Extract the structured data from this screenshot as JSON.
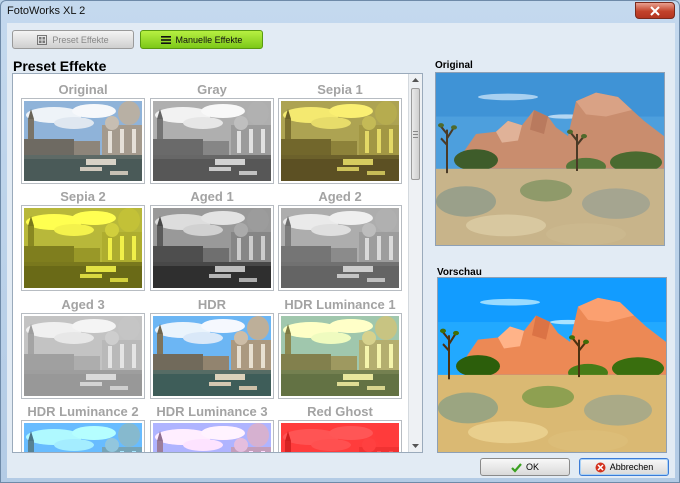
{
  "window": {
    "title": "FotoWorks XL 2"
  },
  "tabs": {
    "preset_label": "Preset Effekte",
    "manual_label": "Manuelle Effekte"
  },
  "section": {
    "title": "Preset Effekte"
  },
  "presets": [
    {
      "label": "Original",
      "filter": "original"
    },
    {
      "label": "Gray",
      "filter": "gray"
    },
    {
      "label": "Sepia 1",
      "filter": "sepia1"
    },
    {
      "label": "Sepia 2",
      "filter": "sepia2"
    },
    {
      "label": "Aged 1",
      "filter": "aged1"
    },
    {
      "label": "Aged 2",
      "filter": "aged2"
    },
    {
      "label": "Aged 3",
      "filter": "aged3"
    },
    {
      "label": "HDR",
      "filter": "hdr"
    },
    {
      "label": "HDR Luminance 1",
      "filter": "hdrlum1"
    },
    {
      "label": "HDR Luminance 2",
      "filter": "hdrlum2"
    },
    {
      "label": "HDR Luminance 3",
      "filter": "hdrlum3"
    },
    {
      "label": "Red Ghost",
      "filter": "redghost"
    }
  ],
  "original": {
    "label": "Original"
  },
  "preview": {
    "label": "Vorschau"
  },
  "buttons": {
    "ok_label": "OK",
    "cancel_label": "Abbrechen"
  },
  "colors": {
    "accent_green": "#8fd624",
    "close_red": "#c2432b",
    "label_gray": "#a3a3a3"
  }
}
